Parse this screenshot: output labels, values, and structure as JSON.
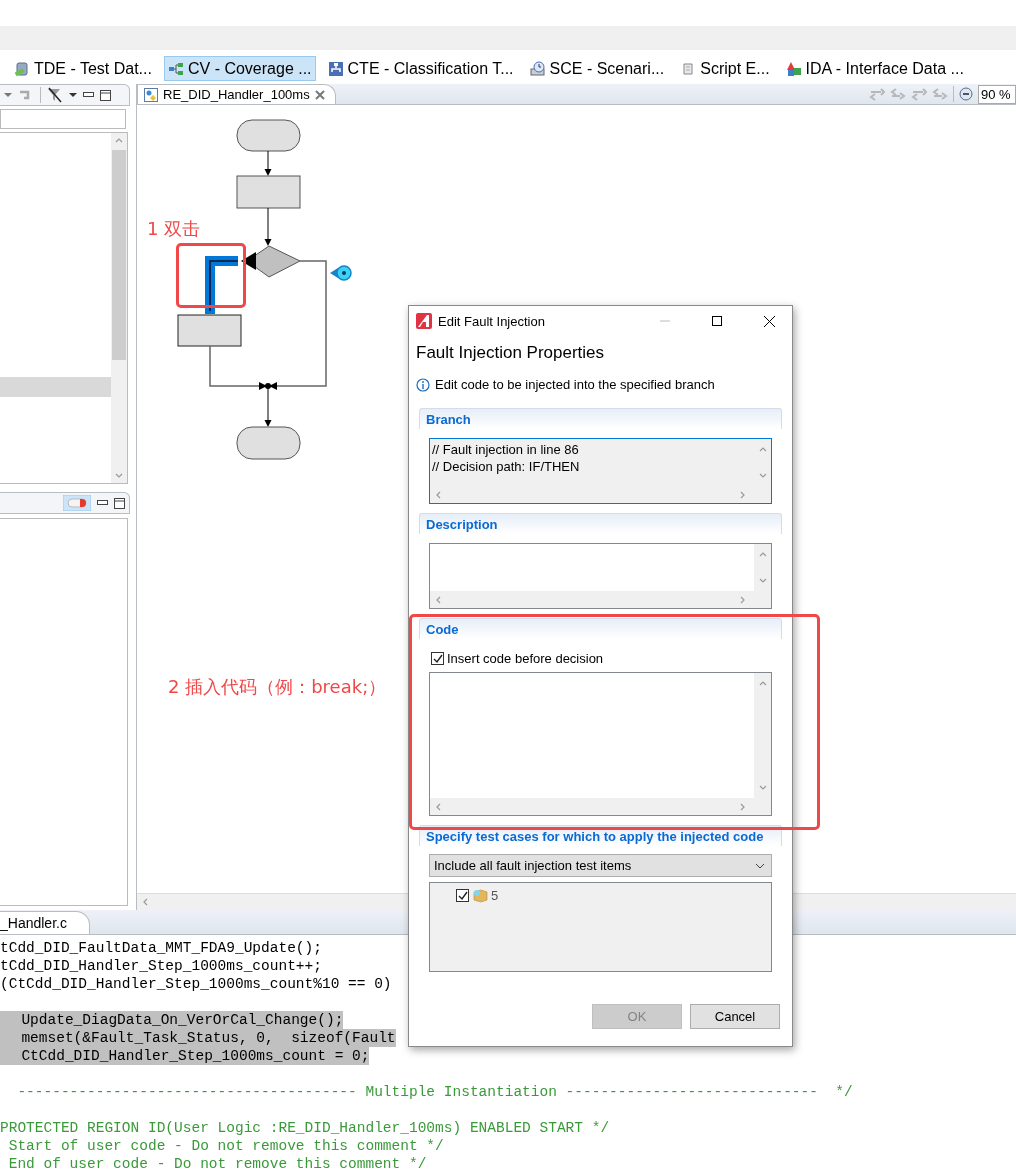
{
  "perspective_tabs": [
    {
      "label": "TDE - Test Dat...",
      "selected": false
    },
    {
      "label": "CV - Coverage ...",
      "selected": true
    },
    {
      "label": "CTE - Classification T...",
      "selected": false
    },
    {
      "label": "SCE - Scenari...",
      "selected": false
    },
    {
      "label": "Script E...",
      "selected": false
    },
    {
      "label": "IDA - Interface Data ...",
      "selected": false
    }
  ],
  "left_panel": {
    "rows": [
      {
        "selected": true
      }
    ]
  },
  "editor": {
    "tab": {
      "label": "RE_DID_Handler_100ms"
    },
    "zoom_field": {
      "value": "90 %"
    }
  },
  "code_editor": {
    "tab": {
      "label": "_Handler.c"
    },
    "lines": [
      {
        "kind": "code",
        "text": "tCdd_DID_FaultData_MMT_FDA9_Update();",
        "highlighted": false
      },
      {
        "kind": "code",
        "text": "tCdd_DID_Handler_Step_1000ms_count++;",
        "highlighted": false
      },
      {
        "kind": "code",
        "text": "(CtCdd_DID_Handler_Step_1000ms_count%10 == 0)",
        "highlighted": false
      },
      {
        "kind": "blank"
      },
      {
        "kind": "code",
        "text": "  Update_DiagData_On_VerOrCal_Change();",
        "highlighted": true
      },
      {
        "kind": "code",
        "text": "  memset(&Fault_Task_Status, 0,  sizeof(Fault",
        "highlighted": true
      },
      {
        "kind": "code",
        "text": "  CtCdd_DID_Handler_Step_1000ms_count = 0;",
        "highlighted": true
      },
      {
        "kind": "blank"
      },
      {
        "kind": "comment",
        "text": "  --------------------------------------- Multiple Instantiation -----------------------------  */"
      },
      {
        "kind": "blank"
      },
      {
        "kind": "comment",
        "text": "PROTECTED REGION ID(User Logic :RE_DID_Handler_100ms) ENABLED START */"
      },
      {
        "kind": "comment",
        "text": " Start of user code - Do not remove this comment */"
      },
      {
        "kind": "comment",
        "text": " End of user code - Do not remove this comment */"
      }
    ]
  },
  "dialog": {
    "title": "Edit Fault Injection",
    "heading": "Fault Injection Properties",
    "info": "Edit code to be injected into the specified branch",
    "sections": [
      {
        "kind": "text",
        "title": "Branch",
        "readonly": true,
        "focused": true,
        "lines": [
          "// Fault injection in line 86",
          "// Decision path: IF/THEN"
        ]
      },
      {
        "kind": "text",
        "title": "Description",
        "readonly": false,
        "focused": false
      },
      {
        "kind": "code",
        "title": "Code",
        "checkbox": {
          "label": "Insert code before decision",
          "checked": true
        }
      },
      {
        "kind": "tests",
        "title": "Specify test cases for which to apply the injected code",
        "dropdown": {
          "value": "Include all fault injection test items"
        },
        "items": [
          {
            "label": "5",
            "checked": true
          }
        ]
      }
    ],
    "buttons": [
      {
        "label": "OK",
        "disabled": true
      },
      {
        "label": "Cancel",
        "disabled": false
      }
    ]
  },
  "annotations": [
    {
      "text": "1 双击"
    },
    {
      "text": "2 插入代码（例：break;）"
    }
  ]
}
